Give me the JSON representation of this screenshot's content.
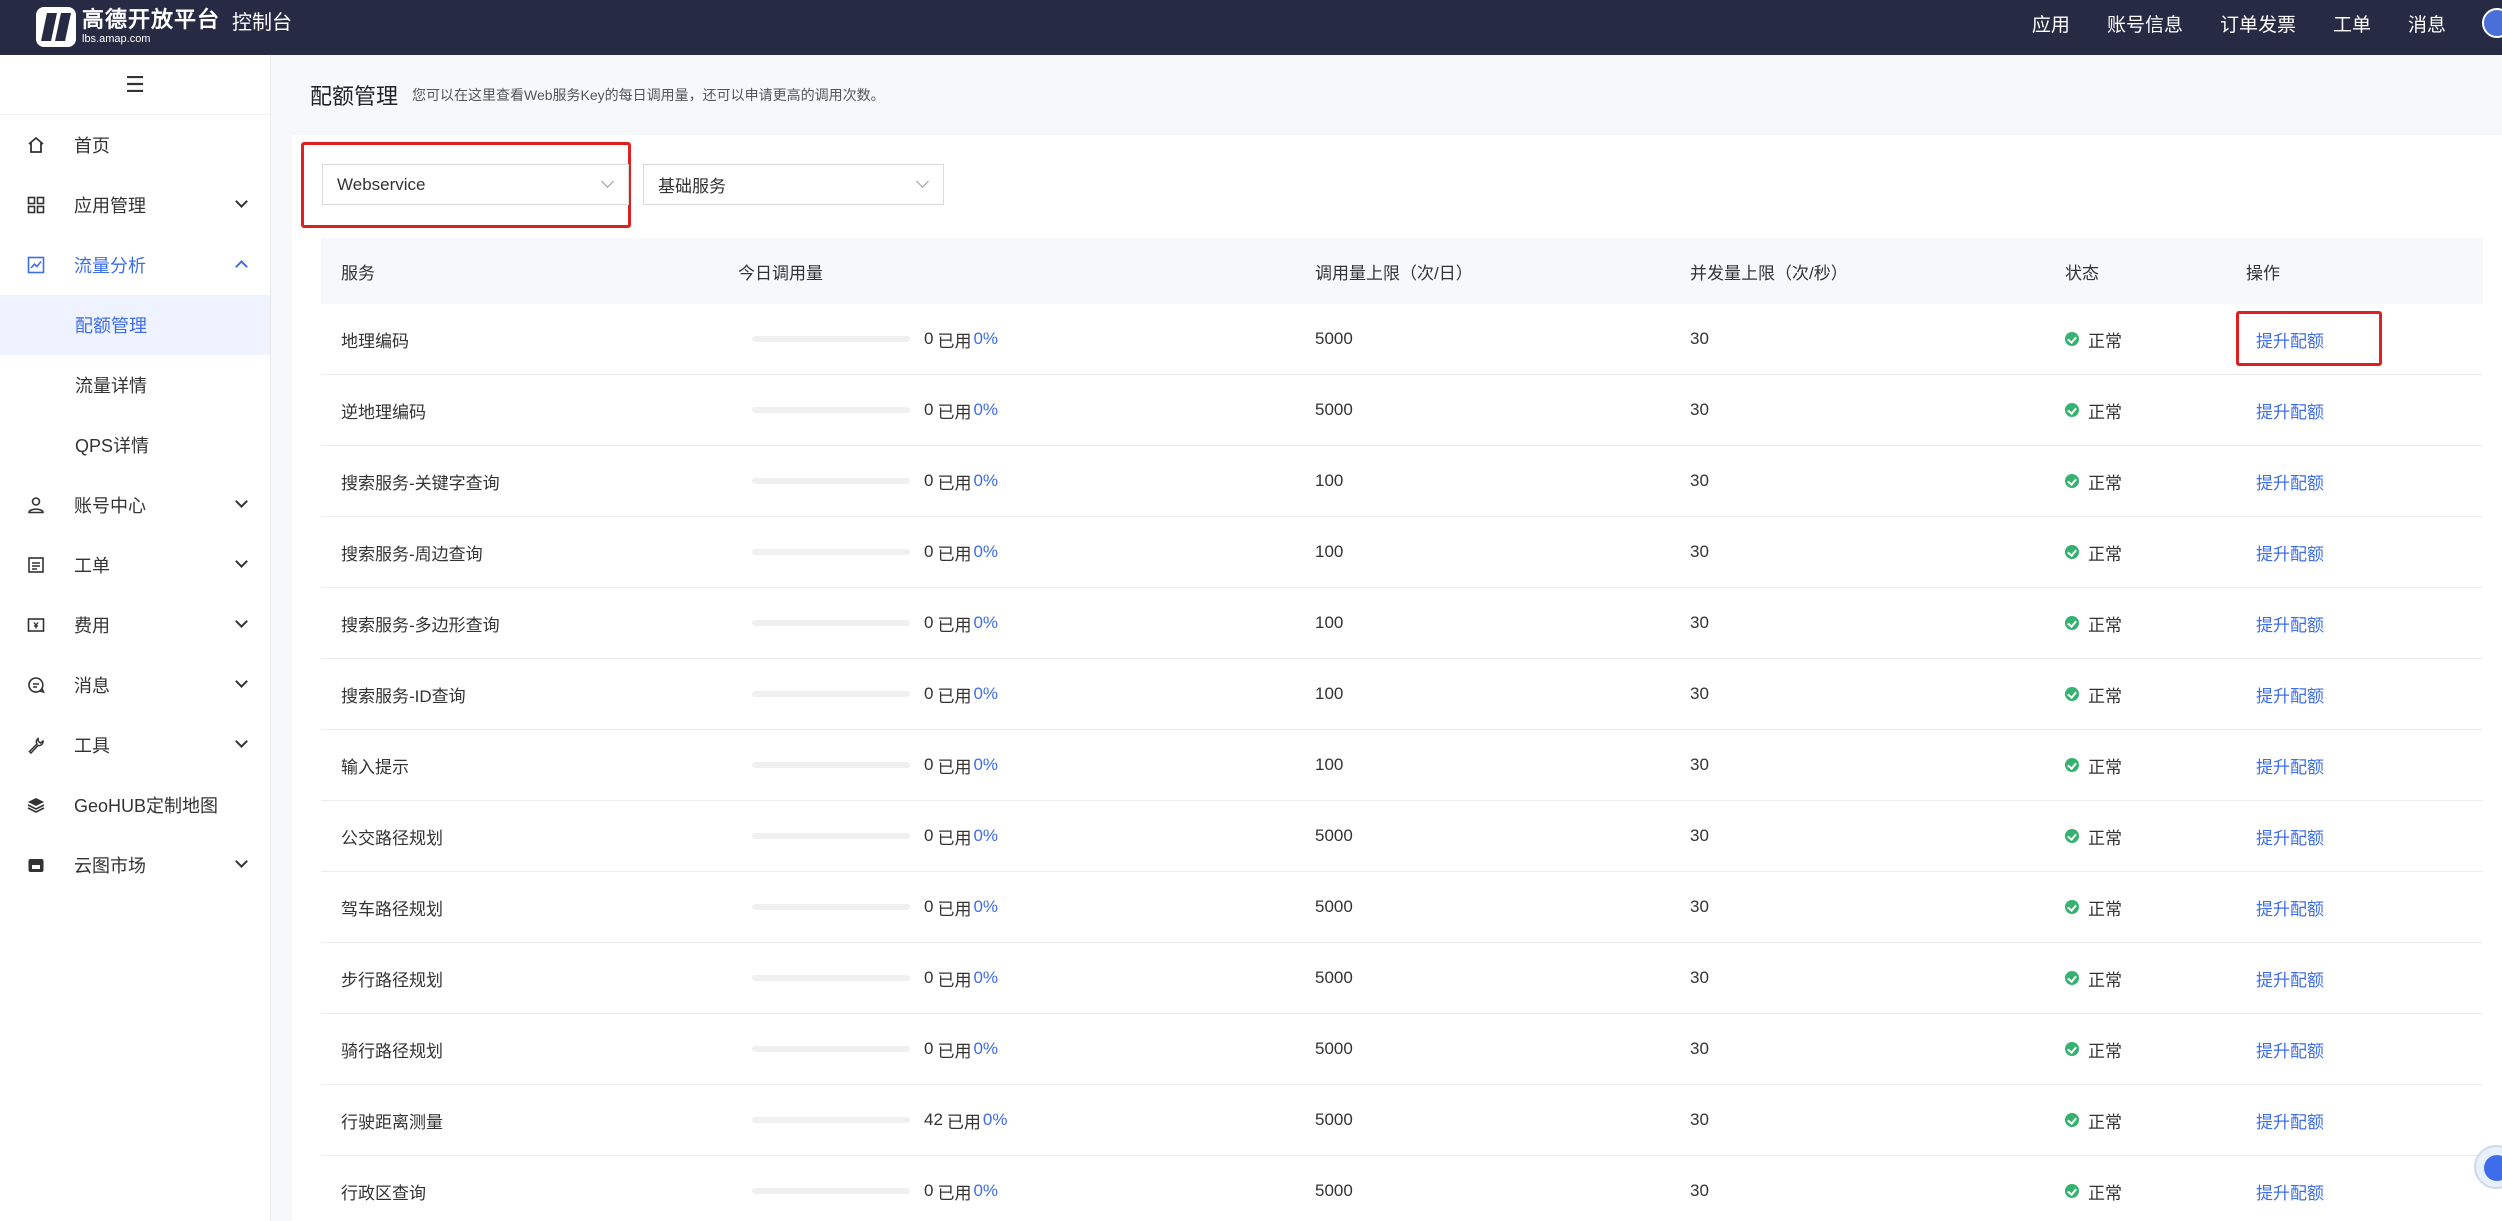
{
  "topbar": {
    "logo_name": "高德开放平台",
    "logo_url": "lbs.amap.com",
    "console_title": "控制台",
    "nav": [
      "应用",
      "账号信息",
      "订单发票",
      "工单",
      "消息"
    ]
  },
  "sidebar": {
    "collapse_icon": "☰",
    "items": [
      {
        "label": "首页",
        "icon": "home-icon"
      },
      {
        "label": "应用管理",
        "icon": "grid-icon"
      },
      {
        "label": "流量分析",
        "icon": "chart-icon"
      },
      {
        "label": "配额管理"
      },
      {
        "label": "流量详情"
      },
      {
        "label": "QPS详情"
      },
      {
        "label": "账号中心",
        "icon": "user-icon"
      },
      {
        "label": "工单",
        "icon": "ticket-icon"
      },
      {
        "label": "费用",
        "icon": "billing-icon"
      },
      {
        "label": "消息",
        "icon": "message-icon"
      },
      {
        "label": "工具",
        "icon": "wrench-icon"
      },
      {
        "label": "GeoHUB定制地图",
        "icon": "layers-icon"
      },
      {
        "label": "云图市场",
        "icon": "store-icon"
      }
    ]
  },
  "page": {
    "title": "配额管理",
    "description": "您可以在这里查看Web服务Key的每日调用量，还可以申请更高的调用次数。"
  },
  "filters": {
    "platform": "Webservice",
    "service_type": "基础服务"
  },
  "table": {
    "headers": [
      "服务",
      "今日调用量",
      "调用量上限（次/日）",
      "并发量上限（次/秒）",
      "状态",
      "操作"
    ],
    "used_label": "已用",
    "status_label": "正常",
    "action_label": "提升配额",
    "rows": [
      {
        "service": "地理编码",
        "count": "0",
        "pct": "0%",
        "daily": "5000",
        "qps": "30"
      },
      {
        "service": "逆地理编码",
        "count": "0",
        "pct": "0%",
        "daily": "5000",
        "qps": "30"
      },
      {
        "service": "搜索服务-关键字查询",
        "count": "0",
        "pct": "0%",
        "daily": "100",
        "qps": "30"
      },
      {
        "service": "搜索服务-周边查询",
        "count": "0",
        "pct": "0%",
        "daily": "100",
        "qps": "30"
      },
      {
        "service": "搜索服务-多边形查询",
        "count": "0",
        "pct": "0%",
        "daily": "100",
        "qps": "30"
      },
      {
        "service": "搜索服务-ID查询",
        "count": "0",
        "pct": "0%",
        "daily": "100",
        "qps": "30"
      },
      {
        "service": "输入提示",
        "count": "0",
        "pct": "0%",
        "daily": "100",
        "qps": "30"
      },
      {
        "service": "公交路径规划",
        "count": "0",
        "pct": "0%",
        "daily": "5000",
        "qps": "30"
      },
      {
        "service": "驾车路径规划",
        "count": "0",
        "pct": "0%",
        "daily": "5000",
        "qps": "30"
      },
      {
        "service": "步行路径规划",
        "count": "0",
        "pct": "0%",
        "daily": "5000",
        "qps": "30"
      },
      {
        "service": "骑行路径规划",
        "count": "0",
        "pct": "0%",
        "daily": "5000",
        "qps": "30"
      },
      {
        "service": "行驶距离测量",
        "count": "42",
        "pct": "0%",
        "daily": "5000",
        "qps": "30"
      },
      {
        "service": "行政区查询",
        "count": "0",
        "pct": "0%",
        "daily": "5000",
        "qps": "30"
      }
    ]
  },
  "colors": {
    "topbar": "#272a43",
    "accent": "#3d6dea",
    "status_ok": "#35b26f",
    "highlight": "#e02020"
  }
}
